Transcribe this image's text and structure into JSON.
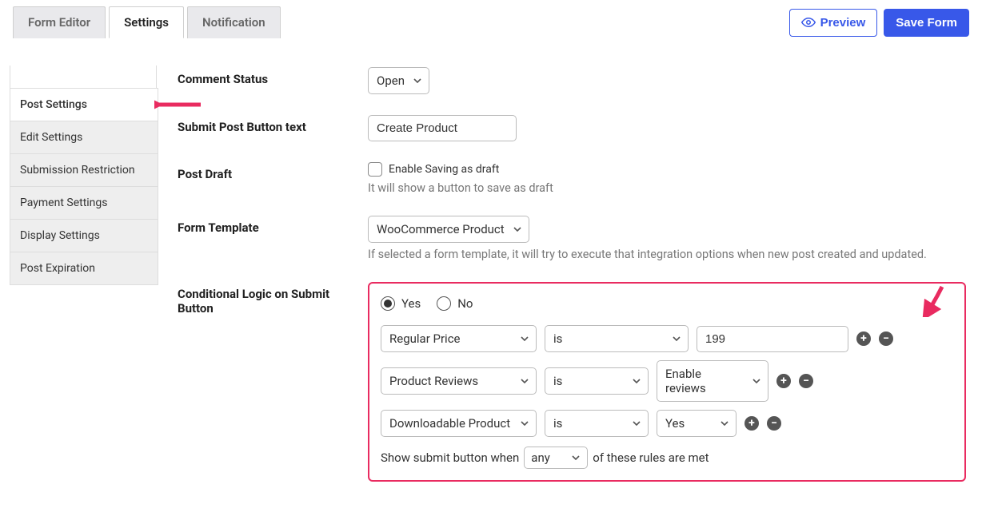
{
  "tabs": {
    "form_editor": "Form Editor",
    "settings": "Settings",
    "notification": "Notification"
  },
  "actions": {
    "preview": "Preview",
    "save": "Save Form"
  },
  "sidebar": {
    "items": [
      "Post Settings",
      "Edit Settings",
      "Submission Restriction",
      "Payment Settings",
      "Display Settings",
      "Post Expiration"
    ]
  },
  "labels": {
    "comment_status": "Comment Status",
    "submit_text": "Submit Post Button text",
    "post_draft": "Post Draft",
    "form_template": "Form Template",
    "cond_logic": "Conditional Logic on Submit Button"
  },
  "values": {
    "comment_status": "Open",
    "submit_text": "Create Product",
    "form_template": "WooCommerce Product"
  },
  "draft": {
    "checkbox_label": "Enable Saving as draft",
    "help": "It will show a button to save as draft"
  },
  "template_help": "If selected a form template, it will try to execute that integration options when new post created and updated.",
  "cond": {
    "yes": "Yes",
    "no": "No",
    "rules": [
      {
        "field": "Regular Price",
        "op": "is",
        "value": "199",
        "value_is_select": false
      },
      {
        "field": "Product Reviews",
        "op": "is",
        "value": "Enable reviews",
        "value_is_select": true
      },
      {
        "field": "Downloadable Product",
        "op": "is",
        "value": "Yes",
        "value_is_select": true
      }
    ],
    "footer_pre": "Show submit button when",
    "footer_match": "any",
    "footer_post": "of these rules are met"
  }
}
